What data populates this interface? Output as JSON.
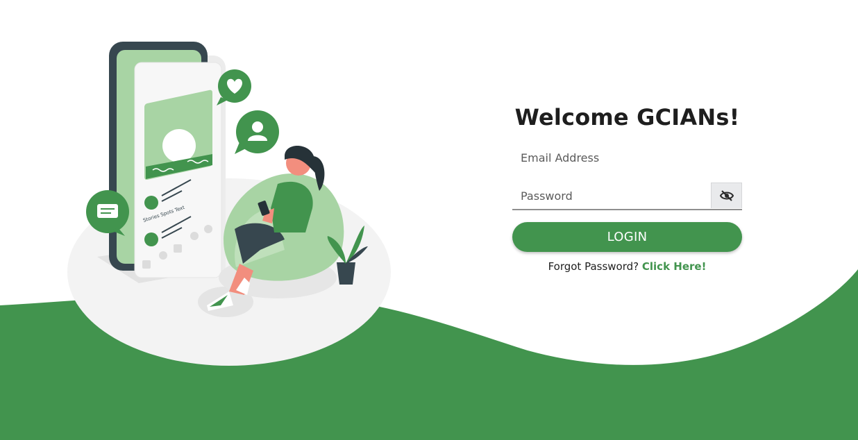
{
  "login": {
    "title": "Welcome GCIANs!",
    "email_placeholder": "Email Address",
    "password_placeholder": "Password",
    "toggle_icon": "eye-slash-icon",
    "button_label": "LOGIN",
    "forgot_prefix": "Forgot Password?",
    "forgot_link": "Click Here!"
  },
  "theme": {
    "accent": "#42944e",
    "light_green": "#a8d4a4",
    "dark": "#37474f",
    "background": "#ffffff"
  }
}
